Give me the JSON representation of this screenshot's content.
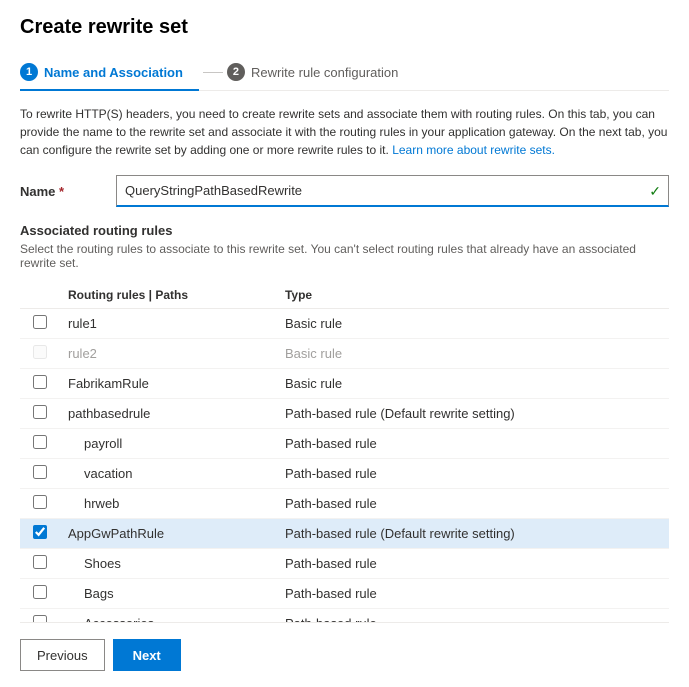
{
  "page": {
    "title": "Create rewrite set"
  },
  "tabs": [
    {
      "id": "name-association",
      "number": "1",
      "label": "Name and Association",
      "active": true
    },
    {
      "id": "rewrite-rule-config",
      "number": "2",
      "label": "Rewrite rule configuration",
      "active": false
    }
  ],
  "description": {
    "text": "To rewrite HTTP(S) headers, you need to create rewrite sets and associate them with routing rules. On this tab, you can provide the name to the rewrite set and associate it with the routing rules in your application gateway. On the next tab, you can configure the rewrite set by adding one or more rewrite rules to it.",
    "link_text": "Learn more about rewrite sets.",
    "link_href": "#"
  },
  "form": {
    "name_label": "Name",
    "name_required": "*",
    "name_value": "QueryStringPathBasedRewrite"
  },
  "routing_section": {
    "title": "Associated routing rules",
    "description": "Select the routing rules to associate to this rewrite set. You can't select routing rules that already have an associated rewrite set."
  },
  "table": {
    "columns": [
      {
        "id": "checkbox",
        "label": ""
      },
      {
        "id": "name",
        "label": "Routing rules | Paths"
      },
      {
        "id": "type",
        "label": "Type"
      }
    ],
    "rows": [
      {
        "id": "rule1",
        "name": "rule1",
        "type": "Basic rule",
        "checked": false,
        "disabled": false,
        "indent": false,
        "selected": false
      },
      {
        "id": "rule2",
        "name": "rule2",
        "type": "Basic rule",
        "checked": false,
        "disabled": true,
        "indent": false,
        "selected": false
      },
      {
        "id": "FabrikamRule",
        "name": "FabrikamRule",
        "type": "Basic rule",
        "checked": false,
        "disabled": false,
        "indent": false,
        "selected": false
      },
      {
        "id": "pathbasedrule",
        "name": "pathbasedrule",
        "type": "Path-based rule (Default rewrite setting)",
        "checked": false,
        "disabled": false,
        "indent": false,
        "selected": false
      },
      {
        "id": "payroll",
        "name": "payroll",
        "type": "Path-based rule",
        "checked": false,
        "disabled": false,
        "indent": true,
        "selected": false
      },
      {
        "id": "vacation",
        "name": "vacation",
        "type": "Path-based rule",
        "checked": false,
        "disabled": false,
        "indent": true,
        "selected": false
      },
      {
        "id": "hrweb",
        "name": "hrweb",
        "type": "Path-based rule",
        "checked": false,
        "disabled": false,
        "indent": true,
        "selected": false
      },
      {
        "id": "AppGwPathRule",
        "name": "AppGwPathRule",
        "type": "Path-based rule (Default rewrite setting)",
        "checked": true,
        "disabled": false,
        "indent": false,
        "selected": true
      },
      {
        "id": "Shoes",
        "name": "Shoes",
        "type": "Path-based rule",
        "checked": false,
        "disabled": false,
        "indent": true,
        "selected": false
      },
      {
        "id": "Bags",
        "name": "Bags",
        "type": "Path-based rule",
        "checked": false,
        "disabled": false,
        "indent": true,
        "selected": false
      },
      {
        "id": "Accessories",
        "name": "Accessories",
        "type": "Path-based rule",
        "checked": false,
        "disabled": false,
        "indent": true,
        "selected": false
      }
    ]
  },
  "footer": {
    "previous_label": "Previous",
    "next_label": "Next"
  }
}
